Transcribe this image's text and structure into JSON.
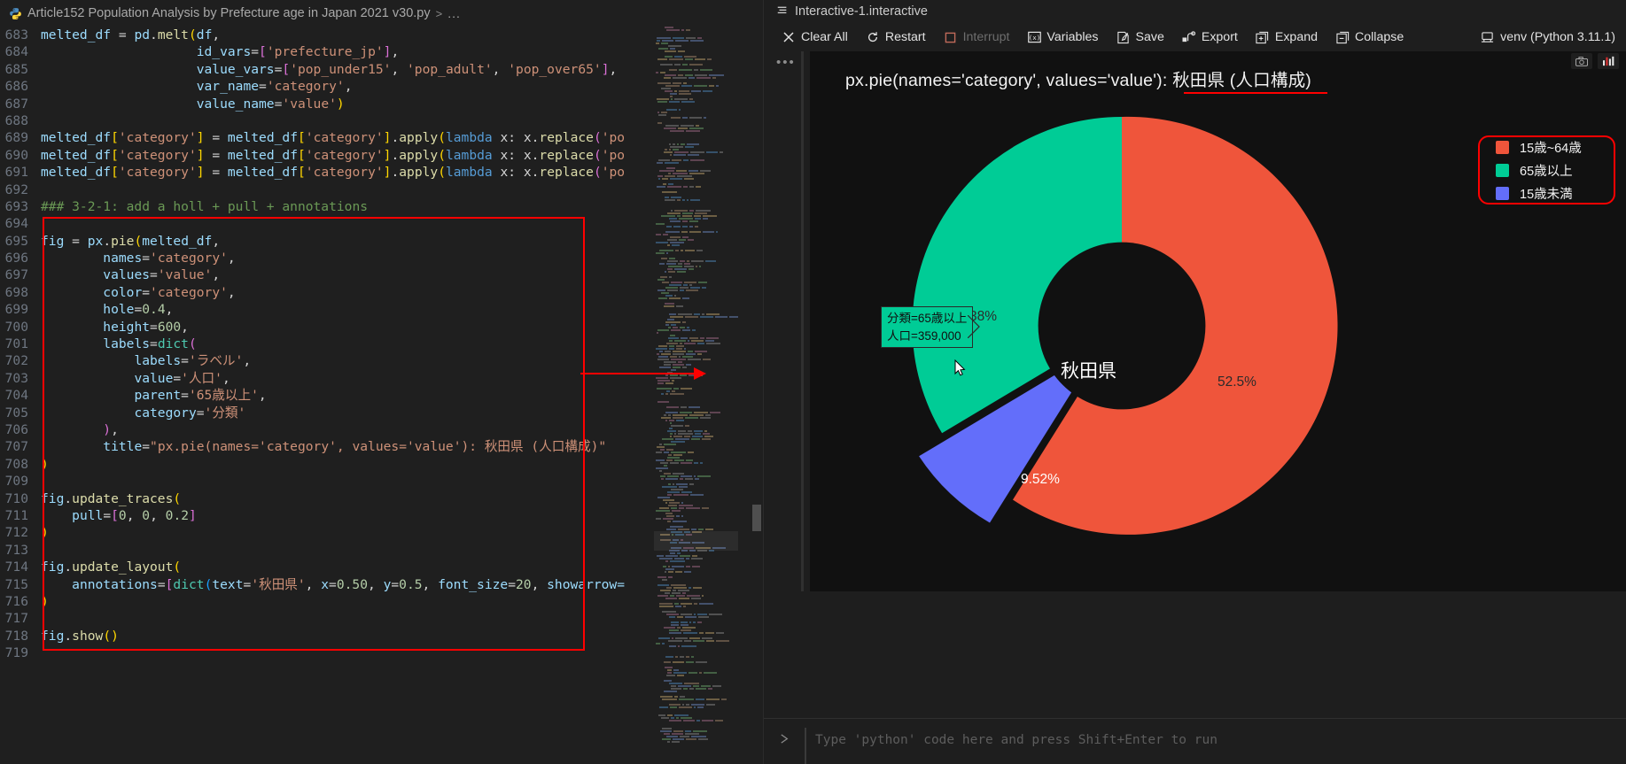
{
  "editor": {
    "breadcrumb": {
      "icon": "python-file-icon",
      "filename": "Article152 Population Analysis by Prefecture age in Japan 2021 v30.py",
      "separator": ">",
      "more": "..."
    },
    "first_line_number": 683,
    "lines": [
      {
        "n": 683,
        "tokens": [
          {
            "t": "melted_df ",
            "c": "v"
          },
          {
            "t": "= ",
            "c": "p"
          },
          {
            "t": "pd",
            "c": "v"
          },
          {
            "t": ".",
            "c": "p"
          },
          {
            "t": "melt",
            "c": "fn"
          },
          {
            "t": "(",
            "c": "y"
          },
          {
            "t": "df",
            "c": "v"
          },
          {
            "t": ",",
            "c": "p"
          }
        ]
      },
      {
        "n": 684,
        "tokens": [
          {
            "t": "                    ",
            "c": "p"
          },
          {
            "t": "id_vars",
            "c": "v"
          },
          {
            "t": "=",
            "c": "p"
          },
          {
            "t": "[",
            "c": "m"
          },
          {
            "t": "'prefecture_jp'",
            "c": "s"
          },
          {
            "t": "]",
            "c": "m"
          },
          {
            "t": ",",
            "c": "p"
          }
        ]
      },
      {
        "n": 685,
        "tokens": [
          {
            "t": "                    ",
            "c": "p"
          },
          {
            "t": "value_vars",
            "c": "v"
          },
          {
            "t": "=",
            "c": "p"
          },
          {
            "t": "[",
            "c": "m"
          },
          {
            "t": "'pop_under15'",
            "c": "s"
          },
          {
            "t": ", ",
            "c": "p"
          },
          {
            "t": "'pop_adult'",
            "c": "s"
          },
          {
            "t": ", ",
            "c": "p"
          },
          {
            "t": "'pop_over65'",
            "c": "s"
          },
          {
            "t": "]",
            "c": "m"
          },
          {
            "t": ",",
            "c": "p"
          }
        ]
      },
      {
        "n": 686,
        "tokens": [
          {
            "t": "                    ",
            "c": "p"
          },
          {
            "t": "var_name",
            "c": "v"
          },
          {
            "t": "=",
            "c": "p"
          },
          {
            "t": "'category'",
            "c": "s"
          },
          {
            "t": ",",
            "c": "p"
          }
        ]
      },
      {
        "n": 687,
        "tokens": [
          {
            "t": "                    ",
            "c": "p"
          },
          {
            "t": "value_name",
            "c": "v"
          },
          {
            "t": "=",
            "c": "p"
          },
          {
            "t": "'value'",
            "c": "s"
          },
          {
            "t": ")",
            "c": "y"
          }
        ]
      },
      {
        "n": 688,
        "tokens": []
      },
      {
        "n": 689,
        "tokens": [
          {
            "t": "melted_df",
            "c": "v"
          },
          {
            "t": "[",
            "c": "y"
          },
          {
            "t": "'category'",
            "c": "s"
          },
          {
            "t": "]",
            "c": "y"
          },
          {
            "t": " = ",
            "c": "p"
          },
          {
            "t": "melted_df",
            "c": "v"
          },
          {
            "t": "[",
            "c": "y"
          },
          {
            "t": "'category'",
            "c": "s"
          },
          {
            "t": "]",
            "c": "y"
          },
          {
            "t": ".",
            "c": "p"
          },
          {
            "t": "apply",
            "c": "fn"
          },
          {
            "t": "(",
            "c": "y"
          },
          {
            "t": "lambda",
            "c": "k"
          },
          {
            "t": " x: x.",
            "c": "p"
          },
          {
            "t": "replace",
            "c": "fn"
          },
          {
            "t": "(",
            "c": "m"
          },
          {
            "t": "'po",
            "c": "s"
          }
        ]
      },
      {
        "n": 690,
        "tokens": [
          {
            "t": "melted_df",
            "c": "v"
          },
          {
            "t": "[",
            "c": "y"
          },
          {
            "t": "'category'",
            "c": "s"
          },
          {
            "t": "]",
            "c": "y"
          },
          {
            "t": " = ",
            "c": "p"
          },
          {
            "t": "melted_df",
            "c": "v"
          },
          {
            "t": "[",
            "c": "y"
          },
          {
            "t": "'category'",
            "c": "s"
          },
          {
            "t": "]",
            "c": "y"
          },
          {
            "t": ".",
            "c": "p"
          },
          {
            "t": "apply",
            "c": "fn"
          },
          {
            "t": "(",
            "c": "y"
          },
          {
            "t": "lambda",
            "c": "k"
          },
          {
            "t": " x: x.",
            "c": "p"
          },
          {
            "t": "replace",
            "c": "fn"
          },
          {
            "t": "(",
            "c": "m"
          },
          {
            "t": "'po",
            "c": "s"
          }
        ]
      },
      {
        "n": 691,
        "tokens": [
          {
            "t": "melted_df",
            "c": "v"
          },
          {
            "t": "[",
            "c": "y"
          },
          {
            "t": "'category'",
            "c": "s"
          },
          {
            "t": "]",
            "c": "y"
          },
          {
            "t": " = ",
            "c": "p"
          },
          {
            "t": "melted_df",
            "c": "v"
          },
          {
            "t": "[",
            "c": "y"
          },
          {
            "t": "'category'",
            "c": "s"
          },
          {
            "t": "]",
            "c": "y"
          },
          {
            "t": ".",
            "c": "p"
          },
          {
            "t": "apply",
            "c": "fn"
          },
          {
            "t": "(",
            "c": "y"
          },
          {
            "t": "lambda",
            "c": "k"
          },
          {
            "t": " x: x.",
            "c": "p"
          },
          {
            "t": "replace",
            "c": "fn"
          },
          {
            "t": "(",
            "c": "m"
          },
          {
            "t": "'po",
            "c": "s"
          }
        ]
      },
      {
        "n": 692,
        "tokens": []
      },
      {
        "n": 693,
        "tokens": [
          {
            "t": "### 3-2-1: add a holl + pull + annotations",
            "c": "c"
          }
        ]
      },
      {
        "n": 694,
        "tokens": []
      },
      {
        "n": 695,
        "tokens": [
          {
            "t": "fig ",
            "c": "v"
          },
          {
            "t": "= ",
            "c": "p"
          },
          {
            "t": "px",
            "c": "v"
          },
          {
            "t": ".",
            "c": "p"
          },
          {
            "t": "pie",
            "c": "fn"
          },
          {
            "t": "(",
            "c": "y"
          },
          {
            "t": "melted_df",
            "c": "v"
          },
          {
            "t": ",",
            "c": "p"
          }
        ]
      },
      {
        "n": 696,
        "tokens": [
          {
            "t": "        ",
            "c": "p"
          },
          {
            "t": "names",
            "c": "v"
          },
          {
            "t": "=",
            "c": "p"
          },
          {
            "t": "'category'",
            "c": "s"
          },
          {
            "t": ",",
            "c": "p"
          }
        ]
      },
      {
        "n": 697,
        "tokens": [
          {
            "t": "        ",
            "c": "p"
          },
          {
            "t": "values",
            "c": "v"
          },
          {
            "t": "=",
            "c": "p"
          },
          {
            "t": "'value'",
            "c": "s"
          },
          {
            "t": ",",
            "c": "p"
          }
        ]
      },
      {
        "n": 698,
        "tokens": [
          {
            "t": "        ",
            "c": "p"
          },
          {
            "t": "color",
            "c": "v"
          },
          {
            "t": "=",
            "c": "p"
          },
          {
            "t": "'category'",
            "c": "s"
          },
          {
            "t": ",",
            "c": "p"
          }
        ]
      },
      {
        "n": 699,
        "tokens": [
          {
            "t": "        ",
            "c": "p"
          },
          {
            "t": "hole",
            "c": "v"
          },
          {
            "t": "=",
            "c": "p"
          },
          {
            "t": "0.4",
            "c": "n"
          },
          {
            "t": ",",
            "c": "p"
          }
        ]
      },
      {
        "n": 700,
        "tokens": [
          {
            "t": "        ",
            "c": "p"
          },
          {
            "t": "height",
            "c": "v"
          },
          {
            "t": "=",
            "c": "p"
          },
          {
            "t": "600",
            "c": "n"
          },
          {
            "t": ",",
            "c": "p"
          }
        ]
      },
      {
        "n": 701,
        "tokens": [
          {
            "t": "        ",
            "c": "p"
          },
          {
            "t": "labels",
            "c": "v"
          },
          {
            "t": "=",
            "c": "p"
          },
          {
            "t": "dict",
            "c": "ty"
          },
          {
            "t": "(",
            "c": "m"
          }
        ]
      },
      {
        "n": 702,
        "tokens": [
          {
            "t": "            ",
            "c": "p"
          },
          {
            "t": "labels",
            "c": "v"
          },
          {
            "t": "=",
            "c": "p"
          },
          {
            "t": "'ラベル'",
            "c": "s"
          },
          {
            "t": ",",
            "c": "p"
          }
        ]
      },
      {
        "n": 703,
        "tokens": [
          {
            "t": "            ",
            "c": "p"
          },
          {
            "t": "value",
            "c": "v"
          },
          {
            "t": "=",
            "c": "p"
          },
          {
            "t": "'人口'",
            "c": "s"
          },
          {
            "t": ",",
            "c": "p"
          }
        ]
      },
      {
        "n": 704,
        "tokens": [
          {
            "t": "            ",
            "c": "p"
          },
          {
            "t": "parent",
            "c": "v"
          },
          {
            "t": "=",
            "c": "p"
          },
          {
            "t": "'65歳以上'",
            "c": "s"
          },
          {
            "t": ",",
            "c": "p"
          }
        ]
      },
      {
        "n": 705,
        "tokens": [
          {
            "t": "            ",
            "c": "p"
          },
          {
            "t": "category",
            "c": "v"
          },
          {
            "t": "=",
            "c": "p"
          },
          {
            "t": "'分類'",
            "c": "s"
          }
        ]
      },
      {
        "n": 706,
        "tokens": [
          {
            "t": "        ",
            "c": "p"
          },
          {
            "t": ")",
            "c": "m"
          },
          {
            "t": ",",
            "c": "p"
          }
        ]
      },
      {
        "n": 707,
        "tokens": [
          {
            "t": "        ",
            "c": "p"
          },
          {
            "t": "title",
            "c": "v"
          },
          {
            "t": "=",
            "c": "p"
          },
          {
            "t": "\"px.pie(names='category', values='value'): 秋田県 (人口構成)\"",
            "c": "s"
          }
        ]
      },
      {
        "n": 708,
        "tokens": [
          {
            "t": ")",
            "c": "y"
          }
        ]
      },
      {
        "n": 709,
        "tokens": []
      },
      {
        "n": 710,
        "tokens": [
          {
            "t": "fig",
            "c": "v"
          },
          {
            "t": ".",
            "c": "p"
          },
          {
            "t": "update_traces",
            "c": "fn"
          },
          {
            "t": "(",
            "c": "y"
          }
        ]
      },
      {
        "n": 711,
        "tokens": [
          {
            "t": "    ",
            "c": "p"
          },
          {
            "t": "pull",
            "c": "v"
          },
          {
            "t": "=",
            "c": "p"
          },
          {
            "t": "[",
            "c": "m"
          },
          {
            "t": "0",
            "c": "n"
          },
          {
            "t": ", ",
            "c": "p"
          },
          {
            "t": "0",
            "c": "n"
          },
          {
            "t": ", ",
            "c": "p"
          },
          {
            "t": "0.2",
            "c": "n"
          },
          {
            "t": "]",
            "c": "m"
          }
        ]
      },
      {
        "n": 712,
        "tokens": [
          {
            "t": ")",
            "c": "y"
          }
        ]
      },
      {
        "n": 713,
        "tokens": []
      },
      {
        "n": 714,
        "tokens": [
          {
            "t": "fig",
            "c": "v"
          },
          {
            "t": ".",
            "c": "p"
          },
          {
            "t": "update_layout",
            "c": "fn"
          },
          {
            "t": "(",
            "c": "y"
          }
        ]
      },
      {
        "n": 715,
        "tokens": [
          {
            "t": "    ",
            "c": "p"
          },
          {
            "t": "annotations",
            "c": "v"
          },
          {
            "t": "=",
            "c": "p"
          },
          {
            "t": "[",
            "c": "m"
          },
          {
            "t": "dict",
            "c": "ty"
          },
          {
            "t": "(",
            "c": "b2"
          },
          {
            "t": "text",
            "c": "v"
          },
          {
            "t": "=",
            "c": "p"
          },
          {
            "t": "'秋田県'",
            "c": "s"
          },
          {
            "t": ", ",
            "c": "p"
          },
          {
            "t": "x",
            "c": "v"
          },
          {
            "t": "=",
            "c": "p"
          },
          {
            "t": "0.50",
            "c": "n"
          },
          {
            "t": ", ",
            "c": "p"
          },
          {
            "t": "y",
            "c": "v"
          },
          {
            "t": "=",
            "c": "p"
          },
          {
            "t": "0.5",
            "c": "n"
          },
          {
            "t": ", ",
            "c": "p"
          },
          {
            "t": "font_size",
            "c": "v"
          },
          {
            "t": "=",
            "c": "p"
          },
          {
            "t": "20",
            "c": "n"
          },
          {
            "t": ", ",
            "c": "p"
          },
          {
            "t": "showarrow=",
            "c": "v"
          }
        ]
      },
      {
        "n": 716,
        "tokens": [
          {
            "t": ")",
            "c": "y"
          }
        ]
      },
      {
        "n": 717,
        "tokens": []
      },
      {
        "n": 718,
        "tokens": [
          {
            "t": "fig",
            "c": "v"
          },
          {
            "t": ".",
            "c": "p"
          },
          {
            "t": "show",
            "c": "fn"
          },
          {
            "t": "(",
            "c": "y"
          },
          {
            "t": ")",
            "c": "y"
          }
        ]
      },
      {
        "n": 719,
        "tokens": []
      }
    ],
    "annotation_color": "#ff0000"
  },
  "interactive": {
    "tab": {
      "icon": "notebook-icon",
      "title": "Interactive-1.interactive"
    },
    "toolbar": [
      {
        "id": "clear-all",
        "icon": "close-icon",
        "label": "Clear All",
        "disabled": false
      },
      {
        "id": "restart",
        "icon": "restart-icon",
        "label": "Restart",
        "disabled": false
      },
      {
        "id": "interrupt",
        "icon": "stop-icon",
        "label": "Interrupt",
        "disabled": true
      },
      {
        "id": "variables",
        "icon": "variables-icon",
        "label": "Variables",
        "disabled": false
      },
      {
        "id": "save",
        "icon": "save-icon",
        "label": "Save",
        "disabled": false
      },
      {
        "id": "export",
        "icon": "export-icon",
        "label": "Export",
        "disabled": false
      },
      {
        "id": "expand",
        "icon": "expand-icon",
        "label": "Expand",
        "disabled": false
      },
      {
        "id": "collapse",
        "icon": "collapse-icon",
        "label": "Collapse",
        "disabled": false
      }
    ],
    "kernel": {
      "icon": "server-icon",
      "label": "venv (Python 3.11.1)"
    },
    "cell_dots": "•••",
    "plot_tools": [
      {
        "id": "camera",
        "icon": "camera-icon"
      },
      {
        "id": "chart",
        "icon": "bar-chart-icon"
      }
    ],
    "input_placeholder": "Type 'python' code here and press Shift+Enter to run",
    "run_icon": "run-chevron-icon"
  },
  "chart_data": {
    "type": "pie",
    "variant": "donut",
    "title": "px.pie(names='category', values='value'): 秋田県 (人口構成)",
    "center_annotation": "秋田県",
    "hole": 0.4,
    "pull": [
      0,
      0,
      0.2
    ],
    "background": "#111111",
    "categories": [
      "15歳~64歳",
      "65歳以上",
      "15歳未満"
    ],
    "values": [
      52.5,
      38,
      9.52
    ],
    "value_labels": [
      "52.5%",
      "38%",
      "9.52%"
    ],
    "colors": [
      "#ef553b",
      "#00cc96",
      "#636efa"
    ],
    "legend": {
      "position": "top-right",
      "entries": [
        {
          "label": "15歳~64歳",
          "color": "#ef553b"
        },
        {
          "label": "65歳以上",
          "color": "#00cc96"
        },
        {
          "label": "15歳未満",
          "color": "#636efa"
        }
      ]
    },
    "hover_tooltip": {
      "line1": "分類=65歳以上",
      "line2": "人口=359,000",
      "background": "#00cc96"
    }
  }
}
